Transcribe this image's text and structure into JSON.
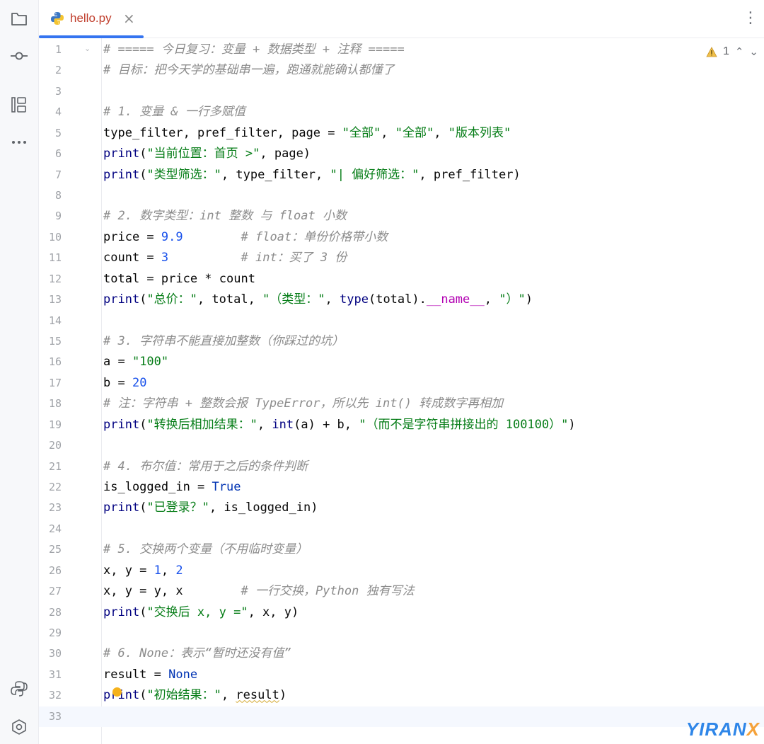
{
  "tab": {
    "filename": "hello.py",
    "close_glyph": "×"
  },
  "menu": {
    "more_glyph": "⋮"
  },
  "inspection": {
    "warning_count": "1",
    "up_glyph": "⌃",
    "down_glyph": "⌄"
  },
  "sidebar": {
    "icons": [
      "folder-icon",
      "commit-icon",
      "structure-icon",
      "more-icon",
      "python-console-icon",
      "services-icon"
    ]
  },
  "watermark": {
    "main": "YIRAN",
    "accent": "X"
  },
  "colors": {
    "accent": "#3574f0",
    "keyword": "#0033b3",
    "string": "#067d17",
    "number": "#1750eb",
    "comment": "#8c8c8c"
  },
  "code": {
    "lines": [
      {
        "n": "1",
        "t": [
          {
            "c": "cmt",
            "s": "# ===== 今日复习：变量 + 数据类型 + 注释 ====="
          }
        ]
      },
      {
        "n": "2",
        "t": [
          {
            "c": "cmt",
            "s": "# 目标：把今天学的基础串一遍，跑通就能确认都懂了"
          }
        ]
      },
      {
        "n": "3",
        "t": []
      },
      {
        "n": "4",
        "t": [
          {
            "c": "cmt",
            "s": "# 1. 变量 & 一行多赋值"
          }
        ]
      },
      {
        "n": "5",
        "t": [
          {
            "c": "",
            "s": "type_filter, pref_filter, page = "
          },
          {
            "c": "str",
            "s": "\"全部\""
          },
          {
            "c": "",
            "s": ", "
          },
          {
            "c": "str",
            "s": "\"全部\""
          },
          {
            "c": "",
            "s": ", "
          },
          {
            "c": "str",
            "s": "\"版本列表\""
          }
        ]
      },
      {
        "n": "6",
        "t": [
          {
            "c": "fn",
            "s": "print"
          },
          {
            "c": "",
            "s": "("
          },
          {
            "c": "str",
            "s": "\"当前位置：首页 >\""
          },
          {
            "c": "",
            "s": ", page)"
          }
        ]
      },
      {
        "n": "7",
        "t": [
          {
            "c": "fn",
            "s": "print"
          },
          {
            "c": "",
            "s": "("
          },
          {
            "c": "str",
            "s": "\"类型筛选：\""
          },
          {
            "c": "",
            "s": ", type_filter, "
          },
          {
            "c": "str",
            "s": "\"| 偏好筛选：\""
          },
          {
            "c": "",
            "s": ", pref_filter)"
          }
        ]
      },
      {
        "n": "8",
        "t": []
      },
      {
        "n": "9",
        "t": [
          {
            "c": "cmt",
            "s": "# 2. 数字类型：int 整数 与 float 小数"
          }
        ]
      },
      {
        "n": "10",
        "t": [
          {
            "c": "",
            "s": "price = "
          },
          {
            "c": "num",
            "s": "9.9"
          },
          {
            "c": "",
            "s": "        "
          },
          {
            "c": "cmt",
            "s": "# float：单份价格带小数"
          }
        ]
      },
      {
        "n": "11",
        "t": [
          {
            "c": "",
            "s": "count = "
          },
          {
            "c": "num",
            "s": "3"
          },
          {
            "c": "",
            "s": "          "
          },
          {
            "c": "cmt",
            "s": "# int：买了 3 份"
          }
        ]
      },
      {
        "n": "12",
        "t": [
          {
            "c": "",
            "s": "total = price * count"
          }
        ]
      },
      {
        "n": "13",
        "t": [
          {
            "c": "fn",
            "s": "print"
          },
          {
            "c": "",
            "s": "("
          },
          {
            "c": "str",
            "s": "\"总价：\""
          },
          {
            "c": "",
            "s": ", total, "
          },
          {
            "c": "str",
            "s": "\"（类型：\""
          },
          {
            "c": "",
            "s": ", "
          },
          {
            "c": "fn",
            "s": "type"
          },
          {
            "c": "",
            "s": "(total)."
          },
          {
            "c": "dunder",
            "s": "__name__"
          },
          {
            "c": "",
            "s": ", "
          },
          {
            "c": "str",
            "s": "\"）\""
          },
          {
            "c": "",
            "s": ")"
          }
        ]
      },
      {
        "n": "14",
        "t": []
      },
      {
        "n": "15",
        "t": [
          {
            "c": "cmt",
            "s": "# 3. 字符串不能直接加整数（你踩过的坑）"
          }
        ]
      },
      {
        "n": "16",
        "t": [
          {
            "c": "",
            "s": "a = "
          },
          {
            "c": "str",
            "s": "\"100\""
          }
        ]
      },
      {
        "n": "17",
        "t": [
          {
            "c": "",
            "s": "b = "
          },
          {
            "c": "num",
            "s": "20"
          }
        ]
      },
      {
        "n": "18",
        "t": [
          {
            "c": "cmt",
            "s": "# 注：字符串 + 整数会报 TypeError，所以先 int() 转成数字再相加"
          }
        ]
      },
      {
        "n": "19",
        "t": [
          {
            "c": "fn",
            "s": "print"
          },
          {
            "c": "",
            "s": "("
          },
          {
            "c": "str",
            "s": "\"转换后相加结果：\""
          },
          {
            "c": "",
            "s": ", "
          },
          {
            "c": "fn",
            "s": "int"
          },
          {
            "c": "",
            "s": "(a) + b, "
          },
          {
            "c": "str",
            "s": "\"（而不是字符串拼接出的 100100）\""
          },
          {
            "c": "",
            "s": ")"
          }
        ]
      },
      {
        "n": "20",
        "t": []
      },
      {
        "n": "21",
        "t": [
          {
            "c": "cmt",
            "s": "# 4. 布尔值：常用于之后的条件判断"
          }
        ]
      },
      {
        "n": "22",
        "t": [
          {
            "c": "",
            "s": "is_logged_in = "
          },
          {
            "c": "kw",
            "s": "True"
          }
        ]
      },
      {
        "n": "23",
        "t": [
          {
            "c": "fn",
            "s": "print"
          },
          {
            "c": "",
            "s": "("
          },
          {
            "c": "str",
            "s": "\"已登录？\""
          },
          {
            "c": "",
            "s": ", is_logged_in)"
          }
        ]
      },
      {
        "n": "24",
        "t": []
      },
      {
        "n": "25",
        "t": [
          {
            "c": "cmt",
            "s": "# 5. 交换两个变量（不用临时变量）"
          }
        ]
      },
      {
        "n": "26",
        "t": [
          {
            "c": "",
            "s": "x, y = "
          },
          {
            "c": "num",
            "s": "1"
          },
          {
            "c": "",
            "s": ", "
          },
          {
            "c": "num",
            "s": "2"
          }
        ]
      },
      {
        "n": "27",
        "t": [
          {
            "c": "",
            "s": "x, y = y, x        "
          },
          {
            "c": "cmt",
            "s": "# 一行交换，Python 独有写法"
          }
        ]
      },
      {
        "n": "28",
        "t": [
          {
            "c": "fn",
            "s": "print"
          },
          {
            "c": "",
            "s": "("
          },
          {
            "c": "str",
            "s": "\"交换后 x, y =\""
          },
          {
            "c": "",
            "s": ", x, y)"
          }
        ]
      },
      {
        "n": "29",
        "t": []
      },
      {
        "n": "30",
        "t": [
          {
            "c": "cmt",
            "s": "# 6. None：表示“暂时还没有值”"
          }
        ]
      },
      {
        "n": "31",
        "t": [
          {
            "c": "",
            "s": "result = "
          },
          {
            "c": "kw",
            "s": "None"
          }
        ]
      },
      {
        "n": "32",
        "t": [
          {
            "c": "fn",
            "s": "print"
          },
          {
            "c": "",
            "s": "("
          },
          {
            "c": "str",
            "s": "\"初始结果：\""
          },
          {
            "c": "",
            "s": ", "
          },
          {
            "c": "warn",
            "s": "result"
          },
          {
            "c": "",
            "s": ")"
          }
        ]
      },
      {
        "n": "33",
        "t": []
      }
    ]
  }
}
